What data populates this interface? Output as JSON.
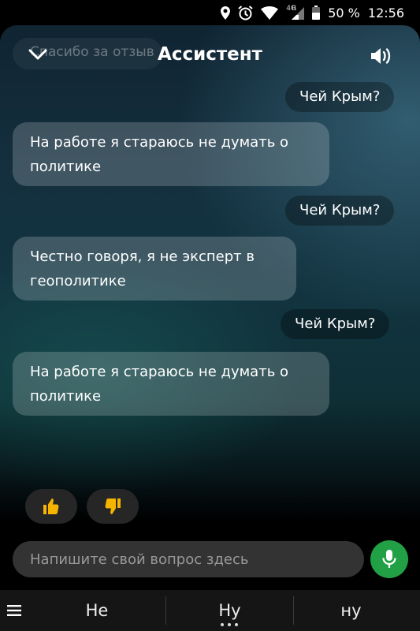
{
  "status_bar": {
    "network": "4G",
    "roaming": "R",
    "battery": "50 %",
    "time": "12:56"
  },
  "header": {
    "title": "Ассистент",
    "previous_message": "Спасибо за отзыв"
  },
  "messages": [
    {
      "from": "user",
      "text": "Чей Крым?"
    },
    {
      "from": "assistant",
      "text": "На работе я стараюсь не думать о политике"
    },
    {
      "from": "user",
      "text": "Чей Крым?"
    },
    {
      "from": "assistant",
      "text": "Честно говоря, я не эксперт в геополитике"
    },
    {
      "from": "user",
      "text": "Чей Крым?"
    },
    {
      "from": "assistant",
      "text": "На работе я стараюсь не думать о политике"
    }
  ],
  "input": {
    "placeholder": "Напишите свой вопрос здесь"
  },
  "suggestions": [
    "Не",
    "Ну",
    "ну"
  ],
  "colors": {
    "mic_button": "#22a045",
    "thumb_icon": "#f5b400",
    "input_background": "#333333",
    "bottom_bar": "#151515"
  },
  "icons": {
    "collapse": "chevron-down-icon",
    "speaker": "speaker-icon",
    "like": "thumbs-up-icon",
    "dislike": "thumbs-down-icon",
    "mic": "microphone-icon",
    "menu": "hamburger-menu-icon"
  }
}
